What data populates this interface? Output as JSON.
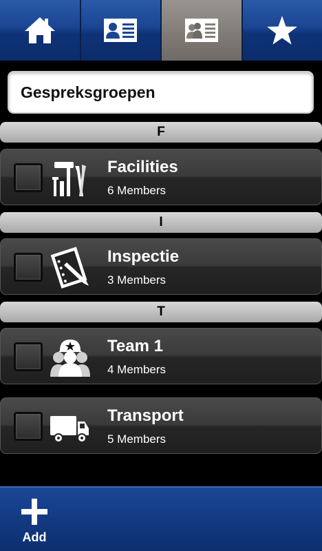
{
  "tabs": [
    {
      "icon": "home-icon"
    },
    {
      "icon": "contact-card-icon"
    },
    {
      "icon": "group-card-icon",
      "active": true
    },
    {
      "icon": "star-icon"
    }
  ],
  "search": {
    "value": "Gespreksgroepen"
  },
  "sections": {
    "f": "F",
    "i": "I",
    "t": "T"
  },
  "groups": [
    {
      "name": "Facilities",
      "members": "6 Members",
      "icon": "tools-icon"
    },
    {
      "name": "Inspectie",
      "members": "3 Members",
      "icon": "clipboard-pen-icon"
    },
    {
      "name": "Team 1",
      "members": "4 Members",
      "icon": "team-helmet-icon"
    },
    {
      "name": "Transport",
      "members": "5 Members",
      "icon": "truck-icon"
    }
  ],
  "bottom": {
    "add_label": "Add"
  },
  "colors": {
    "tab_blue": "#1a4592",
    "tab_active": "#847e79",
    "bottom_blue": "#123a82"
  }
}
